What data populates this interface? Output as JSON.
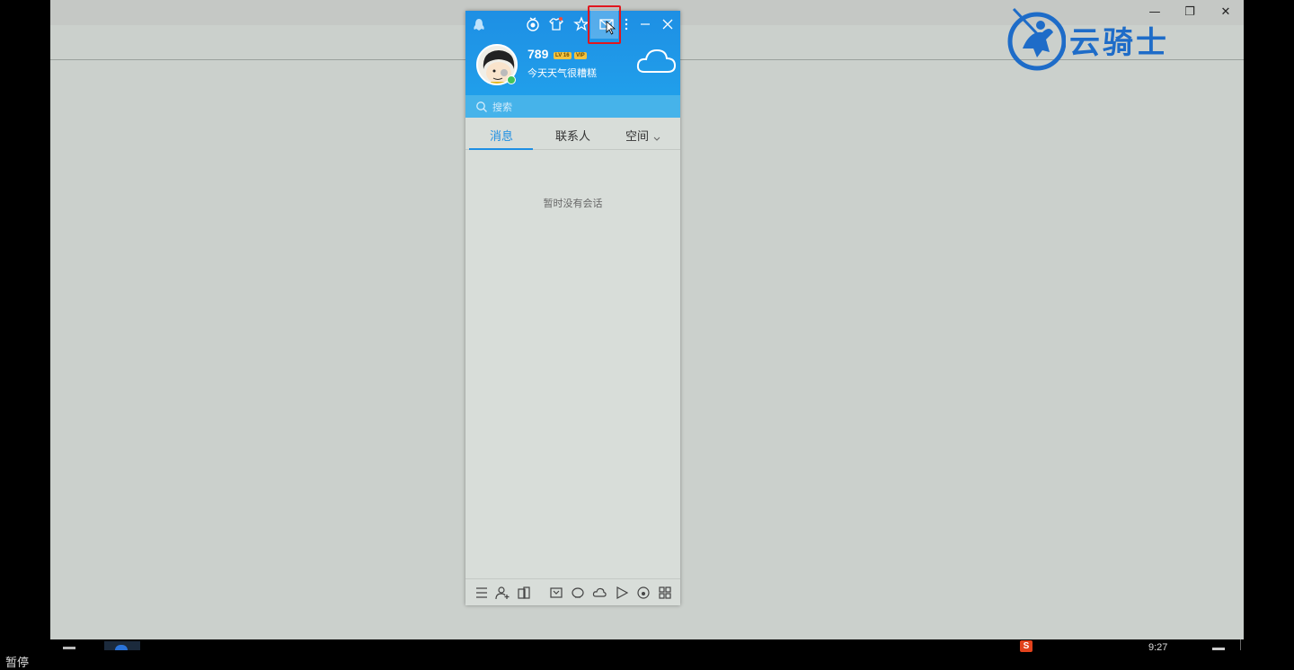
{
  "window_controls": {
    "minimize": "—",
    "restore": "❐",
    "close": "✕"
  },
  "brand": {
    "logo_text": "云骑士",
    "color": "#1e6cc8"
  },
  "qq": {
    "nickname": "789",
    "level_badge": "LV 16",
    "vip_badge": "VIP",
    "signature": "今天天气很糟糕",
    "search_placeholder": "搜索",
    "tabs": [
      {
        "label": "消息",
        "active": true
      },
      {
        "label": "联系人",
        "active": false
      },
      {
        "label": "空间",
        "active": false
      }
    ],
    "empty_text": "暂时没有会话",
    "header_icons": [
      "qq-penguin-icon",
      "medal-icon",
      "tshirt-skin-icon",
      "star-icon",
      "mail-icon",
      "more-icon",
      "minimize-icon",
      "close-icon"
    ],
    "bottom_icons": [
      "menu-icon",
      "add-friend-icon",
      "apps-icon",
      "game-icon",
      "penguin-app-icon",
      "cloud-app-icon",
      "video-icon",
      "music-icon",
      "app-grid-icon"
    ],
    "accent_color": "#1e8fe4"
  },
  "taskbar": {
    "pause_label": "暂停",
    "time": "9:27",
    "ime_label": "S"
  }
}
